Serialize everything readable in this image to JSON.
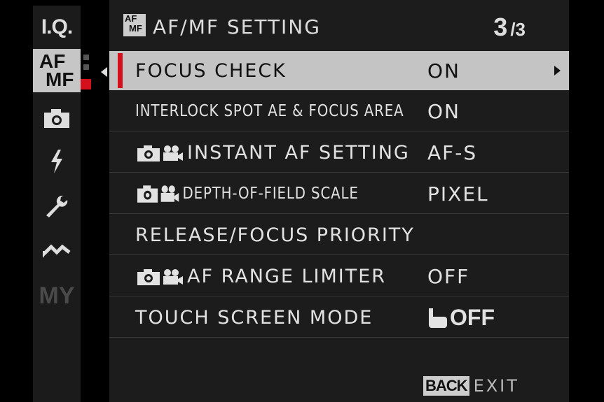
{
  "sidebar": {
    "items": [
      {
        "label": "I.Q.",
        "icon": "image-quality-icon"
      },
      {
        "label_top": "AF",
        "label_bottom": "MF",
        "icon": "af-mf-icon",
        "active": true
      },
      {
        "icon": "camera-icon"
      },
      {
        "icon": "flash-icon"
      },
      {
        "icon": "wrench-icon"
      },
      {
        "icon": "wireless-icon"
      },
      {
        "label": "MY",
        "icon": "my-menu-icon"
      }
    ]
  },
  "header": {
    "icon_top": "AF",
    "icon_bottom": "MF",
    "title": "AF/MF SETTING",
    "page_current": "3",
    "page_total": "/3"
  },
  "rows": [
    {
      "label": "FOCUS CHECK",
      "value": "ON",
      "selected": true
    },
    {
      "label": "INTERLOCK SPOT AE & FOCUS AREA",
      "value": "ON"
    },
    {
      "label": "INSTANT AF SETTING",
      "value": "AF-S",
      "icons": [
        "camera-icon",
        "movie-icon"
      ]
    },
    {
      "label": "DEPTH-OF-FIELD SCALE",
      "value": "PIXEL",
      "icons": [
        "camera-icon",
        "movie-icon"
      ]
    },
    {
      "label": "RELEASE/FOCUS PRIORITY",
      "value": ""
    },
    {
      "label": "AF RANGE LIMITER",
      "value": "OFF",
      "icons": [
        "camera-icon",
        "movie-icon"
      ]
    },
    {
      "label": "TOUCH SCREEN MODE",
      "value": "OFF",
      "value_icon": "touch-hand-icon"
    }
  ],
  "footer": {
    "back_key": "BACK",
    "exit_label": "EXIT"
  },
  "colors": {
    "accent_red": "#d3101c",
    "selected_bg": "#c4c4c4",
    "panel_bg": "#1c1c1c"
  }
}
